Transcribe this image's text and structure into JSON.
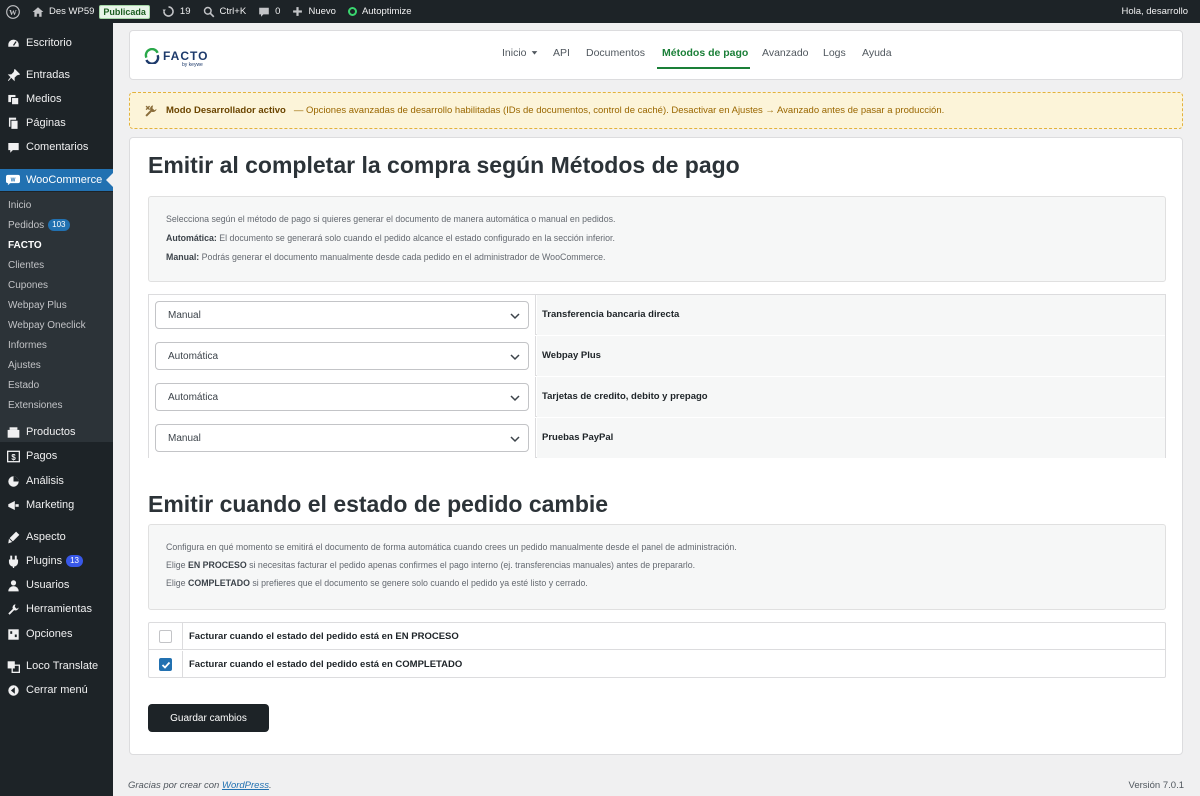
{
  "adminbar": {
    "site_name": "Des WP59",
    "status_badge": "Publicada",
    "updates_count": "19",
    "shortcut": "Ctrl+K",
    "comments_count": "0",
    "new_label": "Nuevo",
    "plugin_label": "Autoptimize",
    "greeting": "Hola, desarrollo"
  },
  "sidebar": {
    "items": [
      {
        "label": "Escritorio",
        "icon": "dashboard-icon"
      },
      {
        "label": "Entradas",
        "icon": "pin-icon"
      },
      {
        "label": "Medios",
        "icon": "media-icon"
      },
      {
        "label": "Páginas",
        "icon": "pages-icon"
      },
      {
        "label": "Comentarios",
        "icon": "comments-icon"
      },
      {
        "label": "WooCommerce",
        "icon": "woocommerce-icon"
      },
      {
        "label": "Productos",
        "icon": "products-icon"
      },
      {
        "label": "Pagos",
        "icon": "payments-icon"
      },
      {
        "label": "Análisis",
        "icon": "analytics-icon"
      },
      {
        "label": "Marketing",
        "icon": "marketing-icon"
      },
      {
        "label": "Aspecto",
        "icon": "appearance-icon"
      },
      {
        "label": "Plugins",
        "icon": "plugins-icon",
        "badge": "13"
      },
      {
        "label": "Usuarios",
        "icon": "users-icon"
      },
      {
        "label": "Herramientas",
        "icon": "tools-icon"
      },
      {
        "label": "Opciones",
        "icon": "settings-icon"
      },
      {
        "label": "Loco Translate",
        "icon": "translate-icon"
      },
      {
        "label": "Cerrar menú",
        "icon": "collapse-icon"
      }
    ],
    "submenu": [
      {
        "label": "Inicio"
      },
      {
        "label": "Pedidos",
        "badge": "103"
      },
      {
        "label": "FACTO"
      },
      {
        "label": "Clientes"
      },
      {
        "label": "Cupones"
      },
      {
        "label": "Webpay Plus"
      },
      {
        "label": "Webpay Oneclick"
      },
      {
        "label": "Informes"
      },
      {
        "label": "Ajustes"
      },
      {
        "label": "Estado"
      },
      {
        "label": "Extensiones"
      }
    ]
  },
  "brand": {
    "logo_text": "FACTO",
    "logo_sub": "by keywe",
    "accent": "#1a7f37"
  },
  "nav": {
    "items": [
      "Inicio",
      "API",
      "Documentos",
      "Métodos de pago",
      "Avanzado",
      "Logs",
      "Ayuda"
    ],
    "active": "Métodos de pago"
  },
  "dev_notice": {
    "title": "Modo Desarrollador activo",
    "text": "— Opciones avanzadas de desarrollo habilitadas (IDs de documentos, control de caché). Desactivar en Ajustes → Avanzado antes de pasar a producción."
  },
  "section1": {
    "title": "Emitir al completar la compra según Métodos de pago",
    "intro": "Selecciona según el método de pago si quieres generar el documento de manera automática o manual en pedidos.",
    "auto_label": "Automática:",
    "auto_text": " El documento se generará solo cuando el pedido alcance el estado configurado en la sección inferior.",
    "manual_label": "Manual:",
    "manual_text": " Podrás generar el documento manualmente desde cada pedido en el administrador de WooCommerce.",
    "methods": [
      {
        "mode": "Manual",
        "name": "Transferencia bancaria directa"
      },
      {
        "mode": "Automática",
        "name": "Webpay Plus"
      },
      {
        "mode": "Automática",
        "name": "Tarjetas de credito, debito y prepago"
      },
      {
        "mode": "Manual",
        "name": "Pruebas PayPal"
      }
    ]
  },
  "section2": {
    "title": "Emitir cuando el estado de pedido cambie",
    "line1": "Configura en qué momento se emitirá el documento de forma automática cuando crees un pedido manualmente desde el panel de administración.",
    "line2_pre": "Elige ",
    "line2_bold": "EN PROCESO",
    "line2_post": " si necesitas facturar el pedido apenas confirmes el pago interno (ej. transferencias manuales) antes de prepararlo.",
    "line3_pre": "Elige ",
    "line3_bold": "COMPLETADO",
    "line3_post": " si prefieres que el documento se genere solo cuando el pedido ya esté listo y cerrado.",
    "options": [
      {
        "label": "Facturar cuando el estado del pedido está en EN PROCESO",
        "checked": false
      },
      {
        "label": "Facturar cuando el estado del pedido está en COMPLETADO",
        "checked": true
      }
    ]
  },
  "save_label": "Guardar cambios",
  "footer": {
    "thanks_pre": "Gracias por crear con ",
    "thanks_link": "WordPress",
    "thanks_post": ".",
    "version": "Versión 7.0.1"
  }
}
